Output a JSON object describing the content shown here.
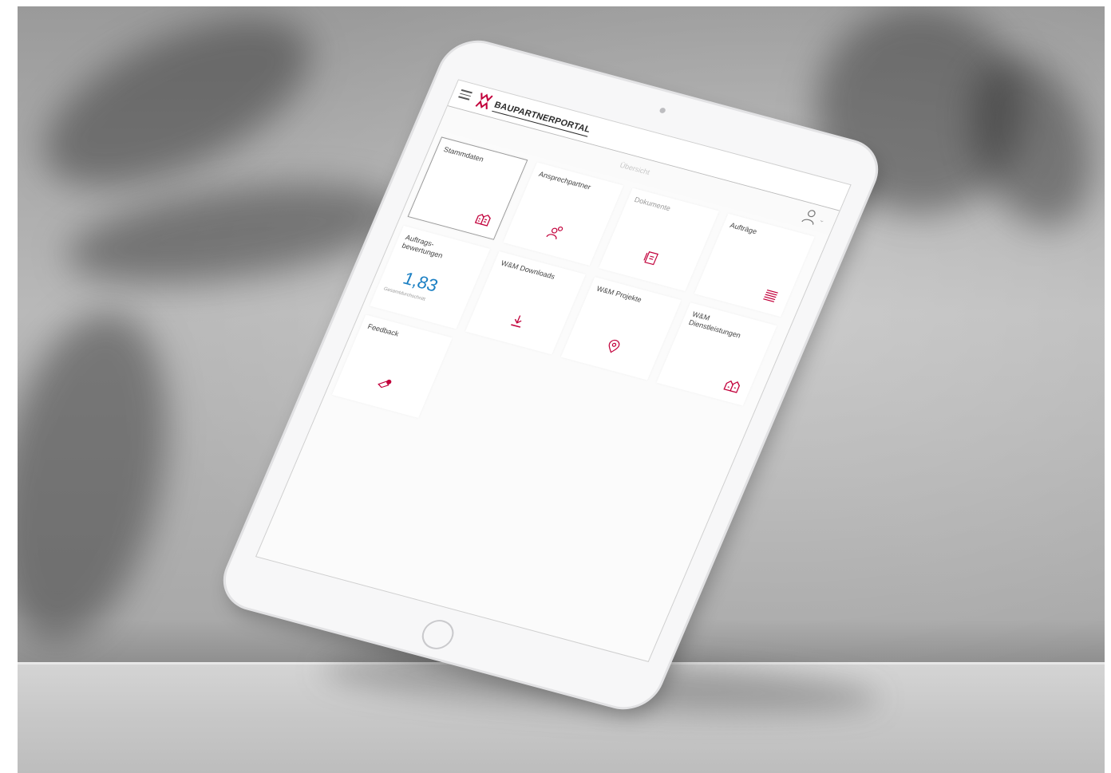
{
  "header": {
    "brand": "BAUPARTNERPORTAL",
    "page_title": "Übersicht"
  },
  "tiles": [
    {
      "label": "Stammdaten",
      "icon": "buildings-icon"
    },
    {
      "label": "Ansprechpartner",
      "icon": "contacts-icon"
    },
    {
      "label": "Dokumente",
      "icon": "documents-icon"
    },
    {
      "label": "Aufträge",
      "icon": "list-icon"
    },
    {
      "label": "Auftrags- bewertungen",
      "value": "1,83",
      "caption": "Gesamtdurchschnitt"
    },
    {
      "label": "W&M Downloads",
      "icon": "download-icon"
    },
    {
      "label": "W&M Projekte",
      "icon": "location-pin-icon"
    },
    {
      "label": "W&M Dienstleistungen",
      "icon": "houses-icon"
    },
    {
      "label": "Feedback",
      "icon": "feedback-icon"
    }
  ],
  "colors": {
    "accent": "#c2003b",
    "value_blue": "#1a7fc3"
  }
}
